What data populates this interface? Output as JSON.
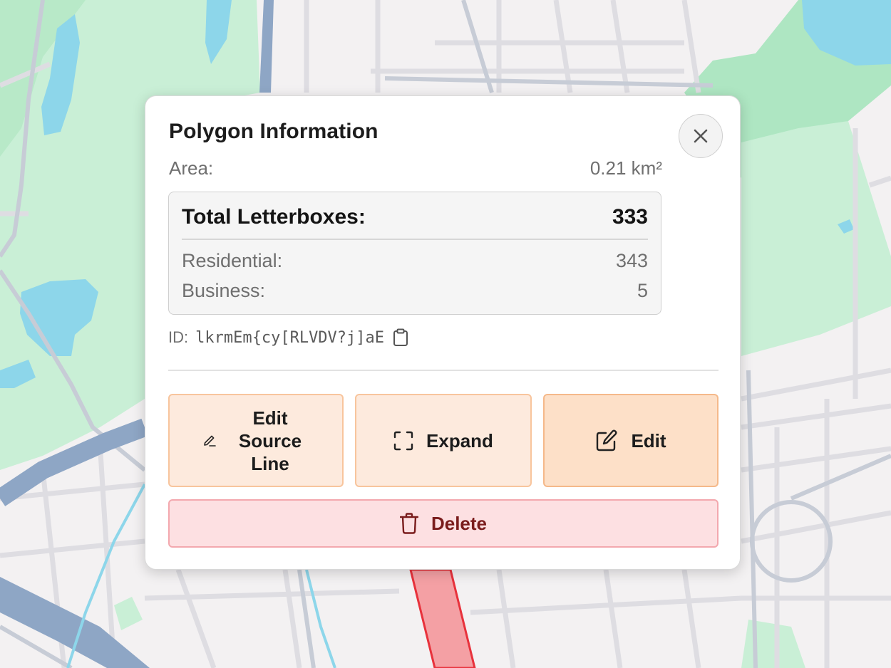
{
  "popup": {
    "title": "Polygon Information",
    "area_label": "Area:",
    "area_value": "0.21 km²",
    "total_label": "Total Letterboxes:",
    "total_value": "333",
    "residential_label": "Residential:",
    "residential_value": "343",
    "business_label": "Business:",
    "business_value": "5",
    "id_label": "ID:",
    "id_value": "lkrmEm{cy[RLVDV?j]aE"
  },
  "actions": {
    "edit_source_line": "Edit Source Line",
    "expand": "Expand",
    "edit": "Edit",
    "delete": "Delete"
  },
  "icons": {
    "close": "close-icon",
    "copy": "clipboard-icon",
    "edit_source_line": "pen-line-icon",
    "expand": "expand-icon",
    "edit": "edit-square-icon",
    "delete": "trash-icon"
  },
  "colors": {
    "map_background": "#f3f1f2",
    "park": "#c9efd6",
    "water": "#8dd6ea",
    "highway": "#8ea6c5",
    "selected_polygon": "#f4a0a4",
    "action_button": "#fdeadd",
    "edit_button": "#fde0c8",
    "delete_button": "#fde0e2",
    "delete_text": "#7a1c1c"
  }
}
